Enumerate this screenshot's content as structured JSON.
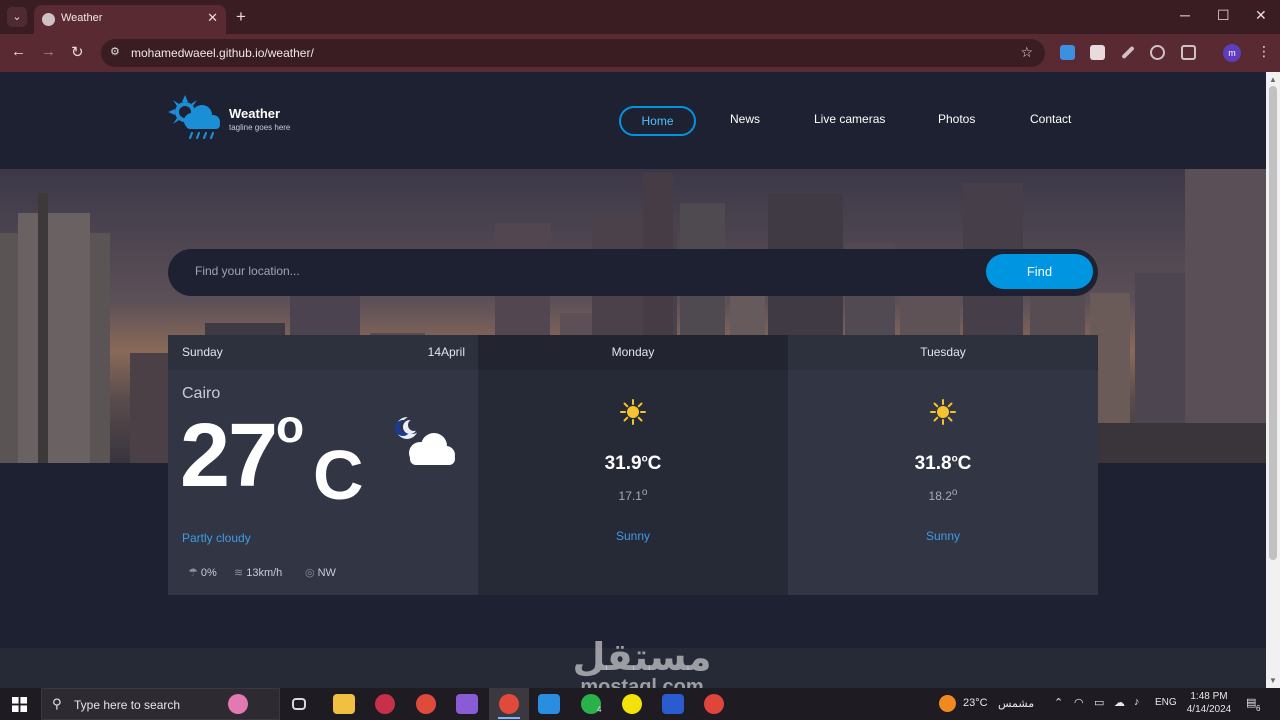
{
  "browser": {
    "tab_title": "Weather",
    "url": "mohamedwaeel.github.io/weather/",
    "profile_initial": "m"
  },
  "site": {
    "logo_title": "Weather",
    "tagline": "tagline goes here",
    "nav": [
      "Home",
      "News",
      "Live cameras",
      "Photos",
      "Contact"
    ],
    "active_nav": "Home"
  },
  "search": {
    "placeholder": "Find your location...",
    "button_label": "Find"
  },
  "today": {
    "day": "Sunday",
    "date": "14April",
    "location": "Cairo",
    "temp": "27",
    "deg": "o",
    "unit": "C",
    "condition": "Partly cloudy",
    "rain": "0%",
    "wind_speed": "13km/h",
    "wind_dir": "NW",
    "icon": "moon-cloud-icon"
  },
  "forecast": [
    {
      "day": "Monday",
      "high": "31.9",
      "low": "17.1",
      "condition": "Sunny",
      "icon": "sun-icon"
    },
    {
      "day": "Tuesday",
      "high": "31.8",
      "low": "18.2",
      "condition": "Sunny",
      "icon": "sun-icon"
    }
  ],
  "units": {
    "deg": "o",
    "c": "C"
  },
  "watermark": {
    "arabic": "مستقل",
    "latin": "mostaql.com"
  },
  "taskbar": {
    "search_placeholder": "Type here to search",
    "weather_temp": "23°C",
    "weather_label": "مشمس",
    "language": "ENG",
    "time": "1:48 PM",
    "date": "4/14/2024",
    "notifications": "6",
    "whatsapp_badge": "4"
  },
  "colors": {
    "accent": "#0095e0",
    "condition_text": "#3f9be7",
    "page_bg": "#1e2131",
    "card_bg": "#323544",
    "browser_frame": "#5a2a32"
  }
}
